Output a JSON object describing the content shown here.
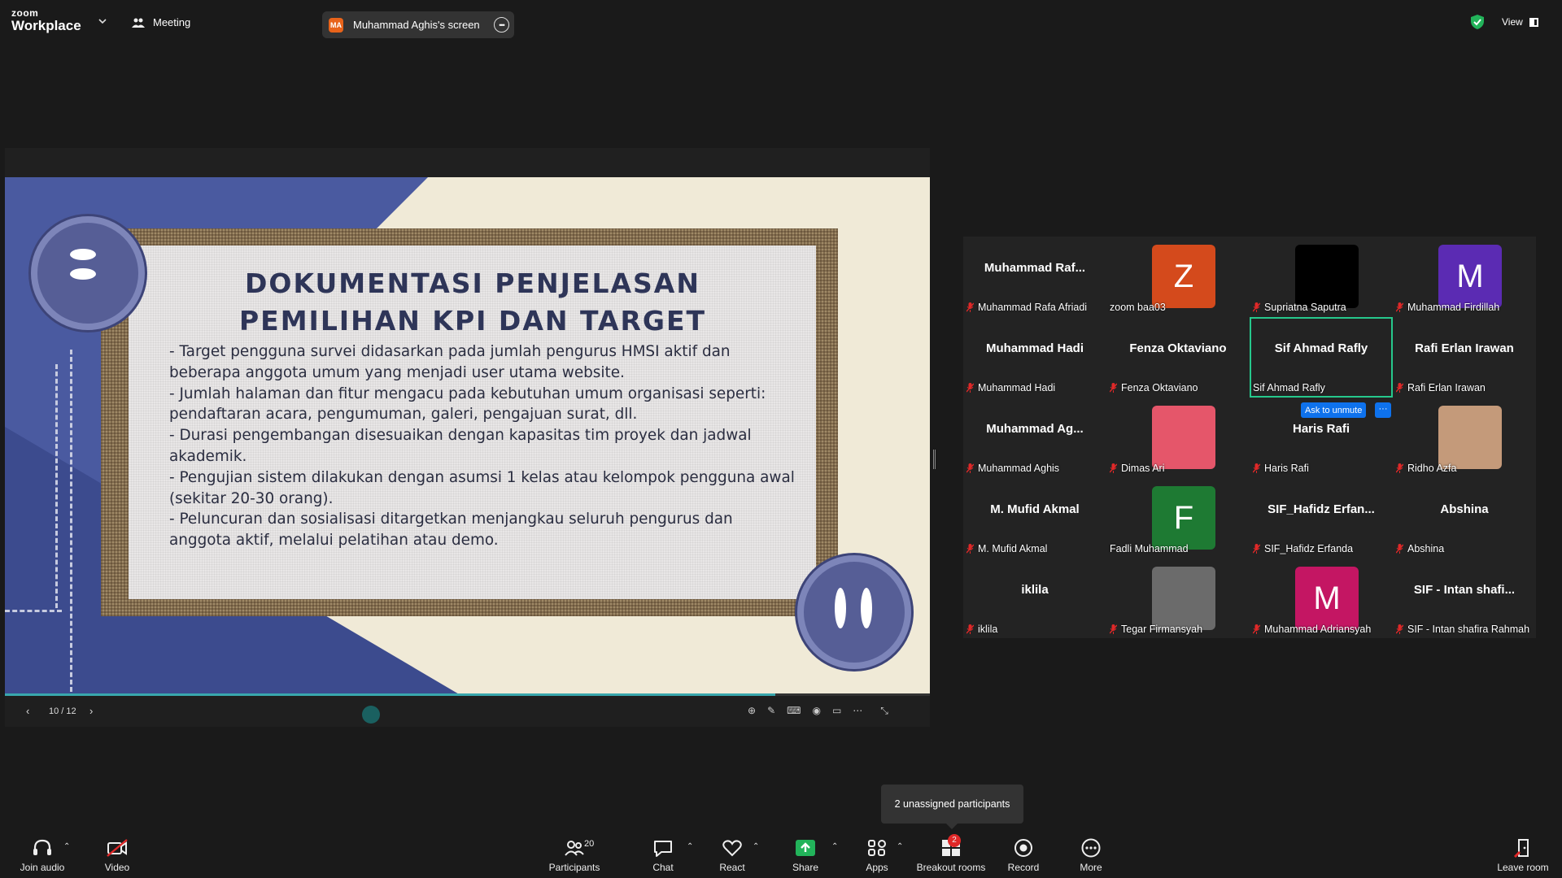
{
  "app": {
    "logo_top": "zoom",
    "logo_bottom": "Workplace",
    "meeting_label": "Meeting",
    "screen_initials": "MA",
    "screen_title": "Muhammad Aghis's screen",
    "view_label": "View"
  },
  "slide": {
    "title_line1": "DOKUMENTASI PENJELASAN",
    "title_line2": "PEMILIHAN KPI DAN TARGET",
    "body": "- Target pengguna survei didasarkan pada jumlah pengurus HMSI aktif dan beberapa anggota umum yang menjadi user utama website.\n - Jumlah halaman dan fitur mengacu pada kebutuhan umum organisasi seperti: pendaftaran acara, pengumuman, galeri, pengajuan surat, dll.\n - Durasi pengembangan disesuaikan dengan kapasitas tim proyek dan jadwal akademik.\n - Pengujian sistem dilakukan dengan asumsi 1 kelas atau kelompok pengguna awal (sekitar 20-30 orang).\n - Peluncuran dan sosialisasi ditargetkan menjangkau seluruh pengurus dan anggota aktif, melalui pelatihan atau demo.",
    "page_indicator": "10 / 12",
    "progress_fraction": 0.833
  },
  "gallery": {
    "tiles": [
      {
        "big": "Muhammad Raf...",
        "name": "Muhammad Rafa Afriadi",
        "avatar": "",
        "avatar_color": "",
        "muted": true
      },
      {
        "big": "",
        "name": "zoom baa03",
        "avatar": "Z",
        "avatar_color": "#d44a1c",
        "muted": false
      },
      {
        "big": "",
        "name": "Supriatna Saputra",
        "avatar": "",
        "avatar_color": "#000000",
        "muted": true
      },
      {
        "big": "",
        "name": "Muhammad Firdillah",
        "avatar": "M",
        "avatar_color": "#5b2bb3",
        "muted": true
      },
      {
        "big": "Muhammad Hadi",
        "name": "Muhammad Hadi",
        "avatar": "",
        "avatar_color": "",
        "muted": true
      },
      {
        "big": "Fenza Oktaviano",
        "name": "Fenza Oktaviano",
        "avatar": "",
        "avatar_color": "",
        "muted": true
      },
      {
        "big": "Sif Ahmad Rafly",
        "name": "Sif Ahmad Rafly",
        "avatar": "",
        "avatar_color": "",
        "muted": false
      },
      {
        "big": "Rafi Erlan Irawan",
        "name": "Rafi Erlan Irawan",
        "avatar": "",
        "avatar_color": "",
        "muted": true
      },
      {
        "big": "Muhammad Ag...",
        "name": "Muhammad Aghis",
        "avatar": "",
        "avatar_color": "",
        "muted": true
      },
      {
        "big": "",
        "name": "Dimas Ari",
        "avatar": "",
        "avatar_color": "#e5566a",
        "muted": true
      },
      {
        "big": "Haris Rafi",
        "name": "Haris Rafi",
        "avatar": "",
        "avatar_color": "",
        "muted": true
      },
      {
        "big": "",
        "name": "Ridho Azfa",
        "avatar": "",
        "avatar_color": "#c49a7a",
        "muted": true
      },
      {
        "big": "M. Mufid Akmal",
        "name": "M. Mufid Akmal",
        "avatar": "",
        "avatar_color": "",
        "muted": true
      },
      {
        "big": "",
        "name": "Fadli Muhammad",
        "avatar": "F",
        "avatar_color": "#1e7a33",
        "muted": false
      },
      {
        "big": "SIF_Hafidz  Erfan...",
        "name": "SIF_Hafidz Erfanda",
        "avatar": "",
        "avatar_color": "",
        "muted": true
      },
      {
        "big": "Abshina",
        "name": "Abshina",
        "avatar": "",
        "avatar_color": "",
        "muted": true
      },
      {
        "big": "iklila",
        "name": "iklila",
        "avatar": "",
        "avatar_color": "",
        "muted": true
      },
      {
        "big": "",
        "name": "Tegar Firmansyah",
        "avatar": "",
        "avatar_color": "#6b6b6b",
        "muted": true
      },
      {
        "big": "",
        "name": "Muhammad Adriansyah",
        "avatar": "M",
        "avatar_color": "#c41663",
        "muted": true
      },
      {
        "big": "SIF - Intan shafi...",
        "name": "SIF - Intan shafira Rahmah",
        "avatar": "",
        "avatar_color": "",
        "muted": true
      }
    ],
    "ask_to_unmute": "Ask to unmute",
    "more_label": "···"
  },
  "tooltip": "2 unassigned participants",
  "toolbar": {
    "join_audio": "Join audio",
    "video": "Video",
    "participants": "Participants",
    "participants_count": "20",
    "chat": "Chat",
    "react": "React",
    "share": "Share",
    "apps": "Apps",
    "breakout": "Breakout rooms",
    "breakout_badge": "2",
    "record": "Record",
    "more": "More",
    "leave": "Leave room"
  }
}
